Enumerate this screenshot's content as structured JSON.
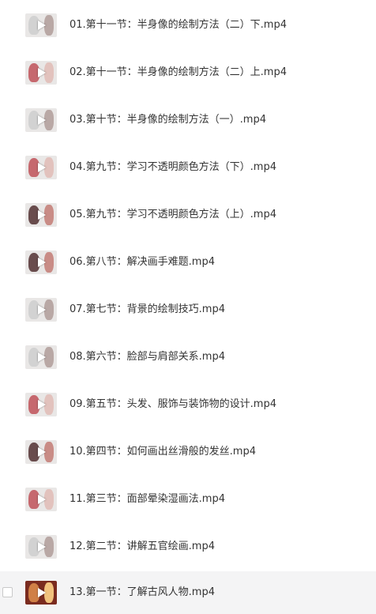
{
  "files": [
    {
      "name": "01.第十一节：半身像的绘制方法（二）下.mp4",
      "thumb_icon": "video-thumbnail",
      "thumb_tone": "pale"
    },
    {
      "name": "02.第十一节：半身像的绘制方法（二）上.mp4",
      "thumb_icon": "video-thumbnail",
      "thumb_tone": "red"
    },
    {
      "name": "03.第十节：半身像的绘制方法（一）.mp4",
      "thumb_icon": "video-thumbnail",
      "thumb_tone": "pale"
    },
    {
      "name": "04.第九节：学习不透明颜色方法（下）.mp4",
      "thumb_icon": "video-thumbnail",
      "thumb_tone": "red"
    },
    {
      "name": "05.第九节：学习不透明颜色方法（上）.mp4",
      "thumb_icon": "video-thumbnail",
      "thumb_tone": "dark"
    },
    {
      "name": "06.第八节：解决画手难题.mp4",
      "thumb_icon": "video-thumbnail",
      "thumb_tone": "dark"
    },
    {
      "name": "07.第七节：背景的绘制技巧.mp4",
      "thumb_icon": "video-thumbnail",
      "thumb_tone": "pale"
    },
    {
      "name": "08.第六节：脸部与肩部关系.mp4",
      "thumb_icon": "video-thumbnail",
      "thumb_tone": "pale"
    },
    {
      "name": "09.第五节：头发、服饰与装饰物的设计.mp4",
      "thumb_icon": "video-thumbnail",
      "thumb_tone": "red"
    },
    {
      "name": "10.第四节：如何画出丝滑般的发丝.mp4",
      "thumb_icon": "video-thumbnail",
      "thumb_tone": "dark"
    },
    {
      "name": "11.第三节：面部晕染湿画法.mp4",
      "thumb_icon": "video-thumbnail",
      "thumb_tone": "red"
    },
    {
      "name": "12.第二节：讲解五官绘画.mp4",
      "thumb_icon": "video-thumbnail",
      "thumb_tone": "pale"
    },
    {
      "name": "13.第一节：了解古风人物.mp4",
      "thumb_icon": "video-thumbnail",
      "thumb_tone": "warm",
      "selected": true
    }
  ],
  "colors": {
    "text": "#333333",
    "selected_row": "#f4f4f5",
    "checkbox_border": "#c9c9c9"
  }
}
